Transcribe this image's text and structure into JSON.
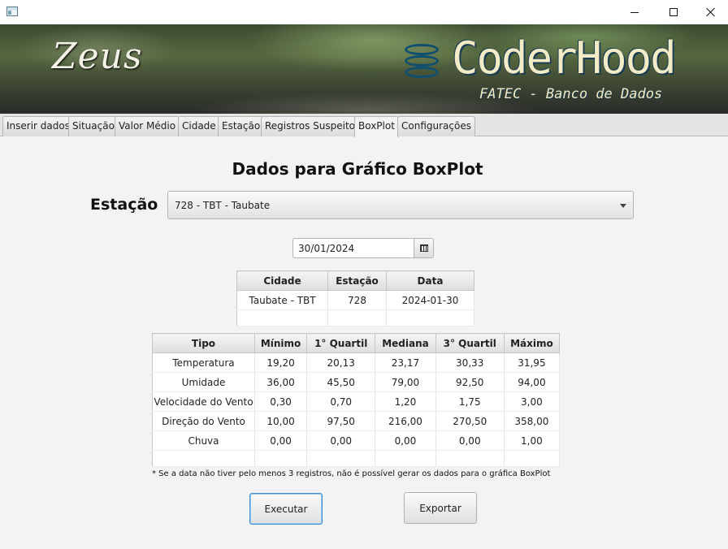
{
  "tabs": [
    {
      "label": "Inserir dados",
      "active": false
    },
    {
      "label": "Situação",
      "active": false
    },
    {
      "label": "Valor Médio",
      "active": false
    },
    {
      "label": "Cidade",
      "active": false
    },
    {
      "label": "Estação",
      "active": false
    },
    {
      "label": "Registros Suspeitos",
      "active": false
    },
    {
      "label": "BoxPlot",
      "active": true
    },
    {
      "label": "Configurações",
      "active": false
    }
  ],
  "banner": {
    "logo_text": "Zeus",
    "brand": "CoderHood",
    "subtitle": "FATEC - Banco de Dados"
  },
  "page": {
    "title": "Dados para Gráfico BoxPlot",
    "station_label": "Estação",
    "station_selected": "728 - TBT - Taubate",
    "date_value": "30/01/2024"
  },
  "info_table": {
    "headers": [
      "Cidade",
      "Estação",
      "Data"
    ],
    "rows": [
      [
        "Taubate - TBT",
        "728",
        "2024-01-30"
      ]
    ]
  },
  "box_table": {
    "headers": [
      "Tipo",
      "Mínimo",
      "1° Quartil",
      "Mediana",
      "3° Quartil",
      "Máximo"
    ],
    "rows": [
      [
        "Temperatura",
        "19,20",
        "20,13",
        "23,17",
        "30,33",
        "31,95"
      ],
      [
        "Umidade",
        "36,00",
        "45,50",
        "79,00",
        "92,50",
        "94,00"
      ],
      [
        "Velocidade do Vento",
        "0,30",
        "0,70",
        "1,20",
        "1,75",
        "3,00"
      ],
      [
        "Direção do Vento",
        "10,00",
        "97,50",
        "216,00",
        "270,50",
        "358,00"
      ],
      [
        "Chuva",
        "0,00",
        "0,00",
        "0,00",
        "0,00",
        "1,00"
      ]
    ]
  },
  "note": "* Se a data não tiver pelo menos 3 registros, não é possível gerar os dados para o gráfica BoxPlot",
  "buttons": {
    "execute": "Executar",
    "export": "Exportar"
  }
}
